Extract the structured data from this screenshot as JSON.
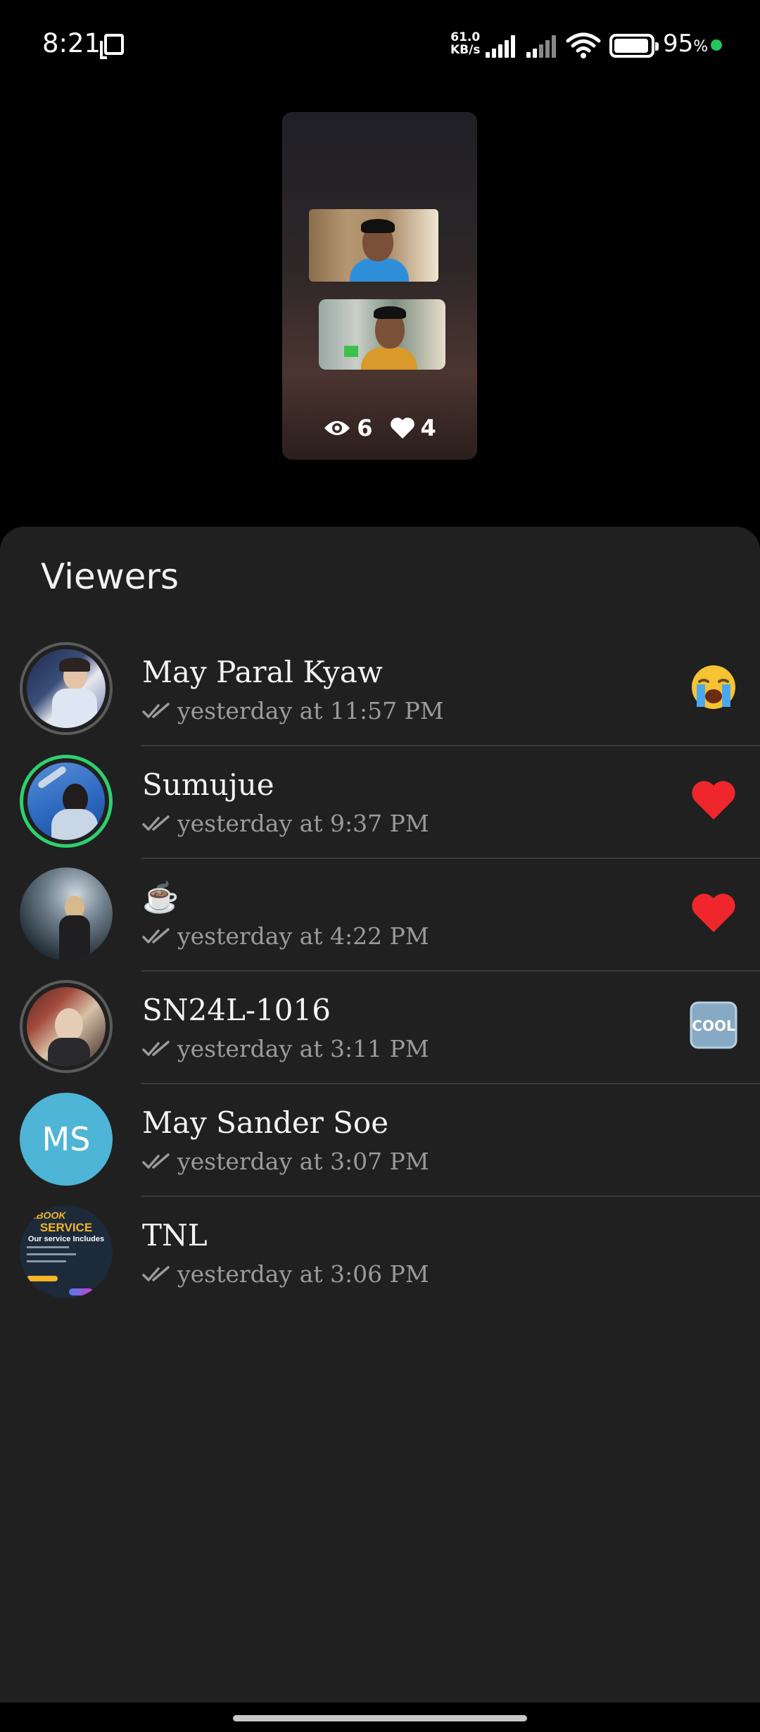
{
  "status_bar": {
    "time": "8:21",
    "net_speed_value": "61.0",
    "net_speed_unit": "KB/s",
    "battery_percent": "95",
    "battery_symbol": "%",
    "battery_level": 0.95,
    "icons": [
      "screen-mirror-icon",
      "signal-icon",
      "signal-icon",
      "wifi-icon",
      "battery-icon",
      "charging-dot"
    ]
  },
  "story": {
    "views": "6",
    "likes": "4",
    "icons": [
      "eye-icon",
      "heart-icon"
    ]
  },
  "sheet": {
    "title": "Viewers",
    "viewers": [
      {
        "name": "May Paral Kyaw",
        "time": "yesterday at 11:57 PM",
        "reaction": "😭",
        "reaction_type": "crying-emoji"
      },
      {
        "name": "Sumujue",
        "time": "yesterday at 9:37 PM",
        "reaction": "heart",
        "reaction_type": "heart"
      },
      {
        "name": "☕",
        "time": "yesterday at 4:22 PM",
        "reaction": "heart",
        "reaction_type": "heart"
      },
      {
        "name": "SN24L-1016",
        "time": "yesterday at 3:11 PM",
        "reaction": "COOL",
        "reaction_type": "cool-emoji"
      },
      {
        "name": "May Sander Soe",
        "time": "yesterday at 3:07 PM",
        "initials": "MS"
      },
      {
        "name": "TNL",
        "time": "yesterday at 3:06 PM",
        "avatar_text_1": "CEBOOK",
        "avatar_text_2": "SERVICE",
        "avatar_text_3": "Our service Includes"
      }
    ]
  },
  "colors": {
    "sheet_bg": "#202020",
    "accent_green": "#2ed06e",
    "heart_red": "#f0262d",
    "initials_bg": "#4fb5d6"
  }
}
